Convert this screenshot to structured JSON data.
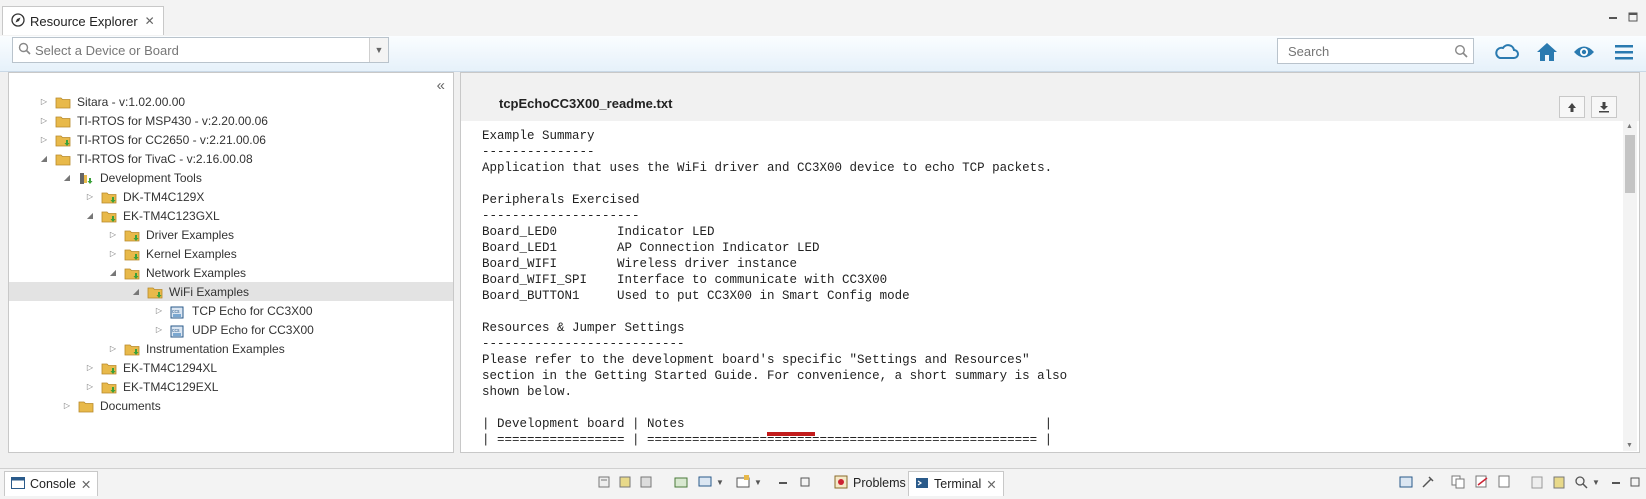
{
  "tab": {
    "title": "Resource Explorer"
  },
  "toolbar": {
    "device_placeholder": "Select a Device or Board",
    "search_placeholder": "Search"
  },
  "tree": [
    {
      "label": "Sitara - v:1.02.00.00",
      "level": 0,
      "state": "collapsed",
      "icon": "folder"
    },
    {
      "label": "TI-RTOS for MSP430 - v:2.20.00.06",
      "level": 0,
      "state": "collapsed",
      "icon": "folder"
    },
    {
      "label": "TI-RTOS for CC2650 - v:2.21.00.06",
      "level": 0,
      "state": "collapsed",
      "icon": "folder-download"
    },
    {
      "label": "TI-RTOS for TivaC - v:2.16.00.08",
      "level": 0,
      "state": "expanded",
      "icon": "folder"
    },
    {
      "label": "Development Tools",
      "level": 1,
      "state": "expanded",
      "icon": "tools-download"
    },
    {
      "label": "DK-TM4C129X",
      "level": 2,
      "state": "collapsed",
      "icon": "folder-download"
    },
    {
      "label": "EK-TM4C123GXL",
      "level": 2,
      "state": "expanded",
      "icon": "folder-download"
    },
    {
      "label": "Driver Examples",
      "level": 3,
      "state": "collapsed",
      "icon": "folder-download"
    },
    {
      "label": "Kernel Examples",
      "level": 3,
      "state": "collapsed",
      "icon": "folder-download"
    },
    {
      "label": "Network Examples",
      "level": 3,
      "state": "expanded",
      "icon": "folder-download"
    },
    {
      "label": "WiFi Examples",
      "level": 4,
      "state": "expanded",
      "icon": "folder-download",
      "selected": true
    },
    {
      "label": "TCP Echo for CC3X00",
      "level": 5,
      "state": "collapsed",
      "icon": "ccs-project"
    },
    {
      "label": "UDP Echo for CC3X00",
      "level": 5,
      "state": "collapsed",
      "icon": "ccs-project"
    },
    {
      "label": "Instrumentation Examples",
      "level": 3,
      "state": "collapsed",
      "icon": "folder-download"
    },
    {
      "label": "EK-TM4C1294XL",
      "level": 2,
      "state": "collapsed",
      "icon": "folder-download"
    },
    {
      "label": "EK-TM4C129EXL",
      "level": 2,
      "state": "collapsed",
      "icon": "folder-download"
    },
    {
      "label": "Documents",
      "level": 1,
      "state": "collapsed",
      "icon": "folder"
    }
  ],
  "content": {
    "file_title": "tcpEchoCC3X00_readme.txt",
    "lines": [
      "Example Summary",
      "---------------",
      "Application that uses the WiFi driver and CC3X00 device to echo TCP packets.",
      "",
      "Peripherals Exercised",
      "---------------------",
      "Board_LED0        Indicator LED",
      "Board_LED1        AP Connection Indicator LED",
      "Board_WIFI        Wireless driver instance",
      "Board_WIFI_SPI    Interface to communicate with CC3X00",
      "Board_BUTTON1     Used to put CC3X00 in Smart Config mode",
      "",
      "Resources & Jumper Settings",
      "---------------------------",
      "Please refer to the development board's specific \"Settings and Resources\"",
      "section in the Getting Started Guide. For convenience, a short summary is also",
      "shown below.",
      "",
      "| Development board | Notes                                                |",
      "| ================= | ==================================================== |"
    ]
  },
  "bottom": {
    "console_label": "Console",
    "problems_label": "Problems",
    "terminal_label": "Terminal"
  },
  "colors": {
    "accent": "#2a7ab0",
    "selection": "#e3e3e3",
    "folder": "#e8b94a",
    "download": "#3aa13a"
  }
}
